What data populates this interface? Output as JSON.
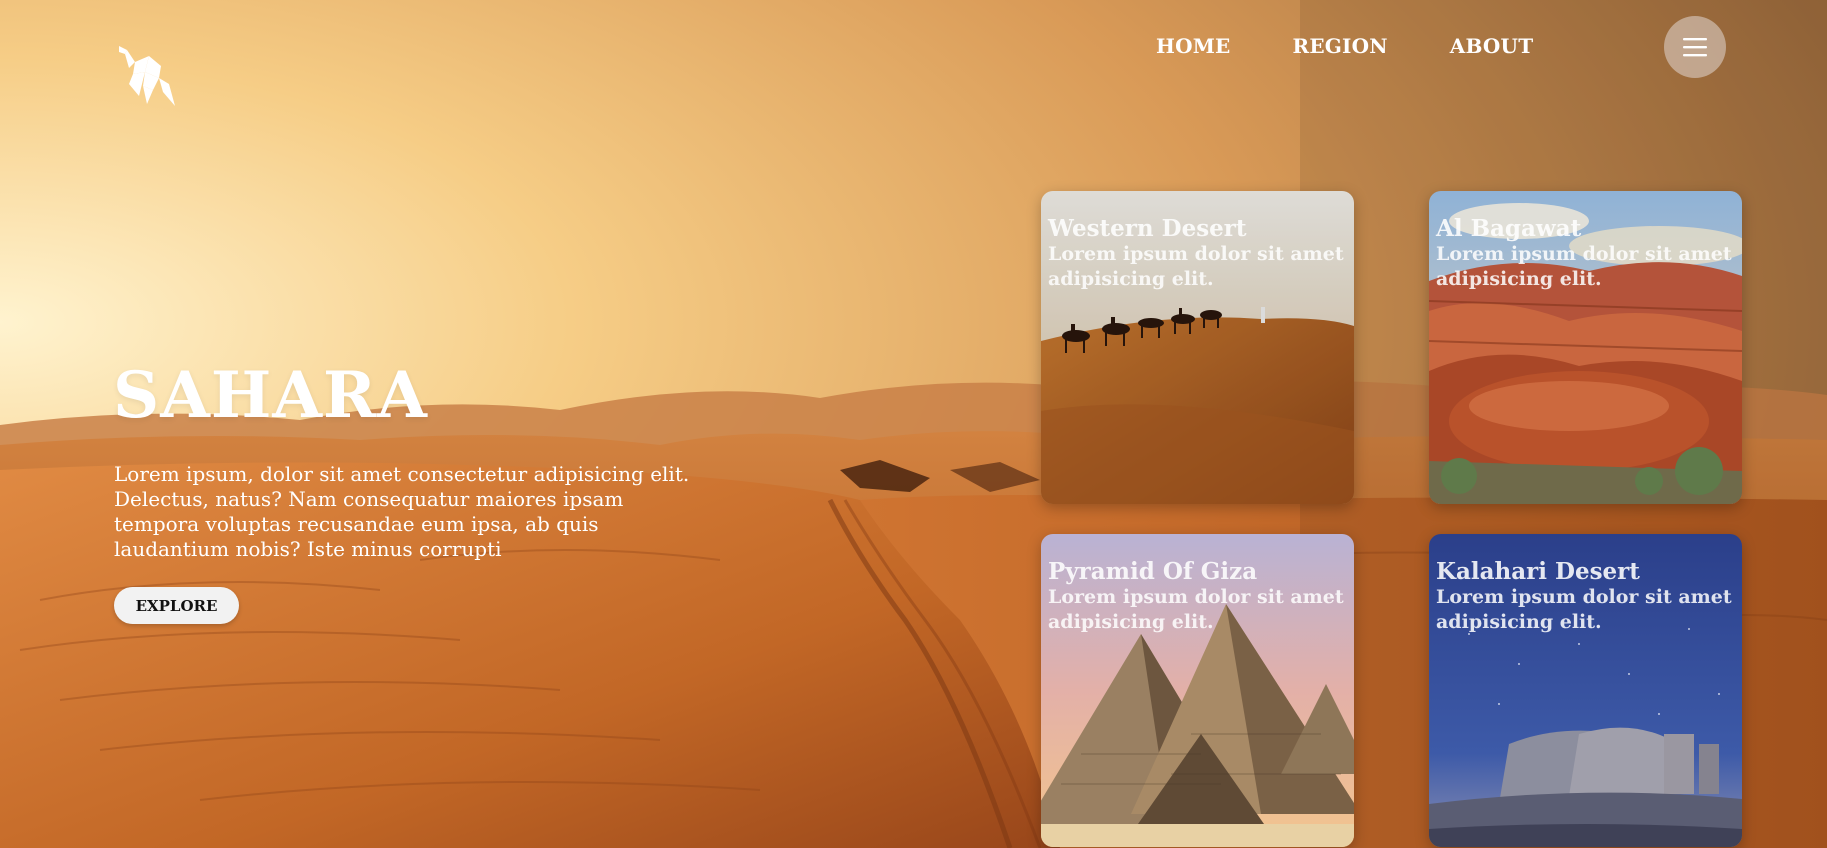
{
  "header": {
    "nav": [
      "HOME",
      "REGION",
      "ABOUT"
    ]
  },
  "hero": {
    "title": "SAHARA",
    "text": "Lorem ipsum, dolor sit amet consectetur adipisicing elit. Delectus, natus? Nam consequatur maiores ipsam tempora voluptas recusandae eum ipsa, ab quis laudantium nobis? Iste minus corrupti",
    "button": "EXPLORE"
  },
  "cards": [
    {
      "title": "Western Desert",
      "desc": "Lorem ipsum dolor sit amet adipisicing elit."
    },
    {
      "title": "Al Bagawat",
      "desc": "Lorem ipsum dolor sit amet adipisicing elit."
    },
    {
      "title": "Pyramid Of Giza",
      "desc": "Lorem ipsum dolor sit amet adipisicing elit."
    },
    {
      "title": "Kalahari Desert",
      "desc": "Lorem ipsum dolor sit amet adipisicing elit."
    }
  ],
  "icons": {
    "logo": "camel-logo-icon",
    "menu": "hamburger-menu-icon"
  },
  "colors": {
    "sky_light": "#fde9b4",
    "sky_mid": "#e8a459",
    "sand": "#c96f2f",
    "sand_dark": "#8a3d14"
  }
}
